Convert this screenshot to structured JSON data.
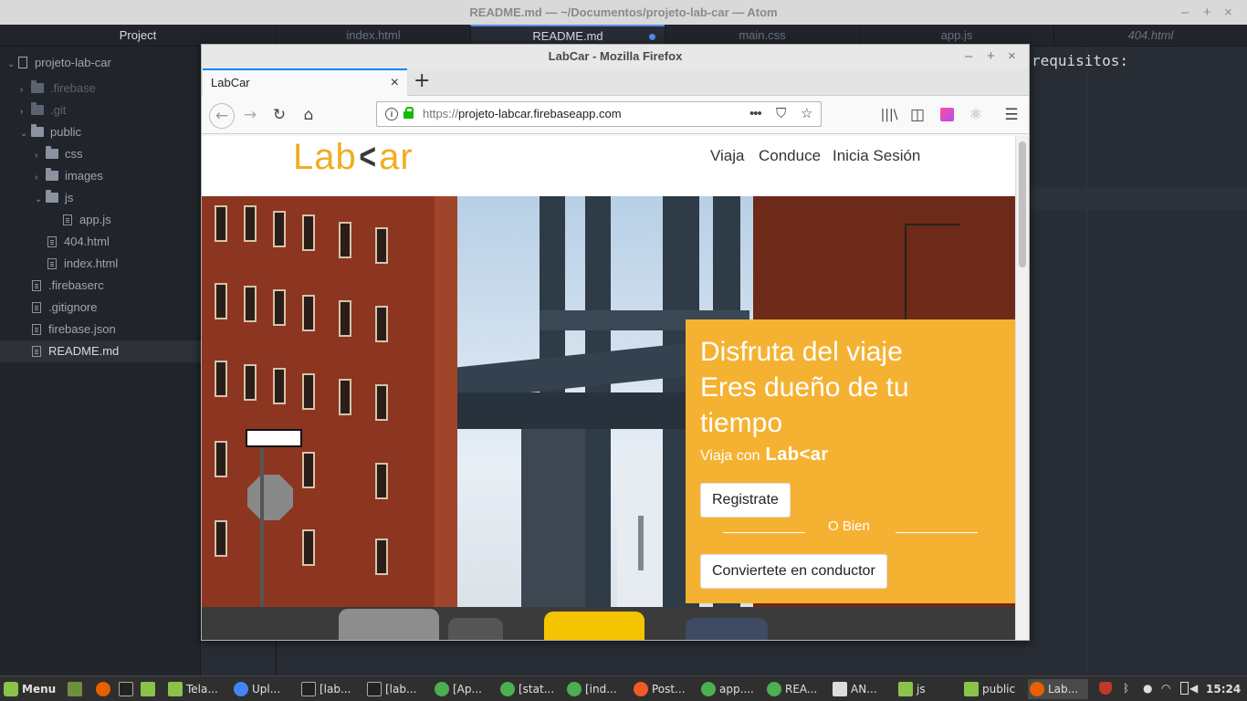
{
  "atom": {
    "title": "README.md — ~/Documentos/projeto-lab-car — Atom",
    "window_controls": [
      "–",
      "+",
      "×"
    ],
    "tree_header": "Project",
    "tree": [
      {
        "label": "projeto-lab-car",
        "kind": "repo"
      },
      {
        "label": ".firebase",
        "kind": "folder"
      },
      {
        "label": ".git",
        "kind": "folder"
      },
      {
        "label": "public",
        "kind": "folder"
      },
      {
        "label": "css",
        "kind": "folder"
      },
      {
        "label": "images",
        "kind": "folder"
      },
      {
        "label": "js",
        "kind": "folder"
      },
      {
        "label": "app.js",
        "kind": "file"
      },
      {
        "label": "404.html",
        "kind": "file"
      },
      {
        "label": "index.html",
        "kind": "file"
      },
      {
        "label": ".firebaserc",
        "kind": "file"
      },
      {
        "label": ".gitignore",
        "kind": "file"
      },
      {
        "label": "firebase.json",
        "kind": "file"
      },
      {
        "label": "README.md",
        "kind": "file"
      }
    ],
    "tabs": [
      "index.html",
      "README.md",
      "main.css",
      "app.js",
      "404.html"
    ],
    "active_tab": "README.md",
    "editor_visible_text": "requisitos:",
    "accent_color": "#568af2"
  },
  "firefox": {
    "title": "LabCar - Mozilla Firefox",
    "window_controls": [
      "–",
      "+",
      "×"
    ],
    "tab_title": "LabCar",
    "tab_close": "×",
    "new_tab": "+",
    "url_protocol": "https://",
    "url_host": "projeto-labcar.firebaseapp.com",
    "url_actions": [
      "•••",
      "pocket-icon",
      "star-icon"
    ],
    "toolbar_icons": [
      "library-icon",
      "sidebar-icon",
      "extension-icon",
      "react-icon",
      "menu-icon"
    ]
  },
  "site": {
    "logo_left": "Lab",
    "logo_mark": "<",
    "logo_right": "ar",
    "nav": [
      "Viaja",
      "Conduce",
      "Inicia Sesión"
    ],
    "hero_title_lines": [
      "Disfruta del viaje",
      "Eres dueño de tu",
      "tiempo"
    ],
    "hero_sub": "Viaja con",
    "hero_sub_logo": "Lab<ar",
    "register_label": "Registrate",
    "or_label": "O Bien",
    "driver_label": "Conviertete en conductor",
    "brand_color": "#f5b232"
  },
  "taskbar": {
    "menu": "Menu",
    "items": [
      "Tela...",
      "Upl...",
      "[lab...",
      "[lab...",
      "[Ap...",
      "[stat...",
      "[ind...",
      "Post...",
      "app....",
      "REA...",
      "AN...",
      "js",
      "public",
      "Lab..."
    ],
    "clock": "15:24"
  }
}
